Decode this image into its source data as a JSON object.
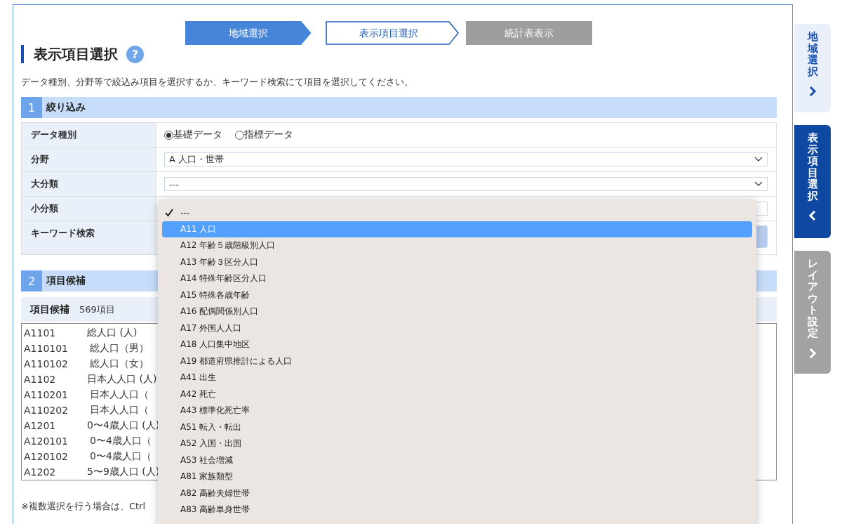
{
  "steps": [
    {
      "label": "地域選択",
      "selected": false,
      "disabled": false
    },
    {
      "label": "表示項目選択",
      "selected": true,
      "disabled": false
    },
    {
      "label": "統計表表示",
      "selected": false,
      "disabled": true
    }
  ],
  "heading": "表示項目選択",
  "help_icon": "?",
  "instruction": "データ種別、分野等で絞込み項目を選択するか、キーワード検索にて項目を選択してください。",
  "filter_section": {
    "number": "1",
    "title": "絞り込み",
    "rows": [
      {
        "label": "データ種別",
        "kind": "radio",
        "options": [
          {
            "label": "基礎データ",
            "selected": true
          },
          {
            "label": "指標データ",
            "selected": false
          }
        ]
      },
      {
        "label": "分野",
        "kind": "select",
        "value": "A 人口・世帯"
      },
      {
        "label": "大分類",
        "kind": "select",
        "value": "---"
      },
      {
        "label": "小分類",
        "kind": "select"
      },
      {
        "label": "キーワード検索",
        "kind": "search"
      }
    ]
  },
  "candidates_section": {
    "number": "2",
    "title": "項目候補",
    "list_title": "項目候補",
    "count": "569項目",
    "items": [
      {
        "code": "A1101",
        "name": "総人口 (人)",
        "indent": false
      },
      {
        "code": "A110101",
        "name": "総人口（男）",
        "indent": true
      },
      {
        "code": "A110102",
        "name": "総人口（女）",
        "indent": true
      },
      {
        "code": "A1102",
        "name": "日本人人口 (人)",
        "indent": false
      },
      {
        "code": "A110201",
        "name": "日本人人口（",
        "indent": true
      },
      {
        "code": "A110202",
        "name": "日本人人口（",
        "indent": true
      },
      {
        "code": "A1201",
        "name": "0〜4歳人口 (人)",
        "indent": false
      },
      {
        "code": "A120101",
        "name": "0〜4歳人口（",
        "indent": true
      },
      {
        "code": "A120102",
        "name": "0〜4歳人口（",
        "indent": true
      },
      {
        "code": "A1202",
        "name": "5〜9歳人口 (人)",
        "indent": false
      }
    ],
    "note": "※複数選択を行う場合は、Ctrl"
  },
  "dropdown": {
    "options": [
      {
        "label": "---",
        "checked": true,
        "highlighted": false
      },
      {
        "label": "A11 人口",
        "checked": false,
        "highlighted": true
      },
      {
        "label": "A12 年齢５歳階級別人口",
        "checked": false,
        "highlighted": false
      },
      {
        "label": "A13 年齢３区分人口",
        "checked": false,
        "highlighted": false
      },
      {
        "label": "A14 特殊年齢区分人口",
        "checked": false,
        "highlighted": false
      },
      {
        "label": "A15 特殊各歳年齢",
        "checked": false,
        "highlighted": false
      },
      {
        "label": "A16 配偶関係別人口",
        "checked": false,
        "highlighted": false
      },
      {
        "label": "A17 外国人人口",
        "checked": false,
        "highlighted": false
      },
      {
        "label": "A18 人口集中地区",
        "checked": false,
        "highlighted": false
      },
      {
        "label": "A19 都道府県推計による人口",
        "checked": false,
        "highlighted": false
      },
      {
        "label": "A41 出生",
        "checked": false,
        "highlighted": false
      },
      {
        "label": "A42 死亡",
        "checked": false,
        "highlighted": false
      },
      {
        "label": "A43 標準化死亡率",
        "checked": false,
        "highlighted": false
      },
      {
        "label": "A51 転入・転出",
        "checked": false,
        "highlighted": false
      },
      {
        "label": "A52 入国・出国",
        "checked": false,
        "highlighted": false
      },
      {
        "label": "A53 社会増減",
        "checked": false,
        "highlighted": false
      },
      {
        "label": "A81 家族類型",
        "checked": false,
        "highlighted": false
      },
      {
        "label": "A82 高齢夫婦世帯",
        "checked": false,
        "highlighted": false
      },
      {
        "label": "A83 高齢単身世帯",
        "checked": false,
        "highlighted": false
      }
    ]
  },
  "side_tabs": [
    {
      "label": "地域選択",
      "selected": false,
      "disabled": false
    },
    {
      "label": "表示項目選択",
      "selected": true,
      "disabled": false
    },
    {
      "label": "レイアウト設定",
      "selected": false,
      "disabled": true
    }
  ]
}
